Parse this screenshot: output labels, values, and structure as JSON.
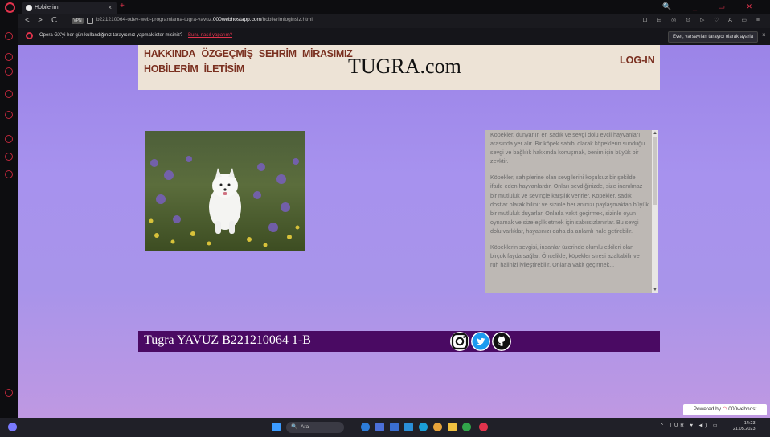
{
  "browser": {
    "tab_title": "Hobilerim",
    "tab_close": "×",
    "new_tab": "+",
    "window_controls": "🔍 _ ▭ ✕",
    "url_prefix": "b221210064-odev-web-programlama-tugra-yavuz.",
    "url_host": "000webhostapp.com",
    "url_path": "/hobilerimloginsiz.html",
    "vpn_label": "VPN",
    "nav_back": "<",
    "nav_forward": ">",
    "nav_reload": "C"
  },
  "infobar": {
    "message": "Opera GX'yi her gün kullandığınız tarayıcınız yapmak ister misiniz?",
    "link": "Bunu nasıl yaparım?",
    "button": "Evet, varsayılan tarayıcı olarak ayarla",
    "close": "×"
  },
  "page": {
    "nav_line1": [
      "HAKKINDA",
      "ÖZGEÇMİŞ",
      "SEHRİM",
      "MİRASIMIZ"
    ],
    "nav_line2": [
      "HOBİLERİM",
      "İLETİSİM"
    ],
    "brand": "TUGRA.com",
    "login": "LOG-IN",
    "paragraphs": [
      "Köpekler, dünyanın en sadık ve sevgi dolu evcil hayvanları arasında yer alır. Bir köpek sahibi olarak köpeklerin sunduğu sevgi ve bağlılık hakkında konuşmak, benim için büyük bir zevktir.",
      "Köpekler, sahiplerine olan sevgilerini koşulsuz bir şekilde ifade eden hayvanlardır. Onları sevdiğinizde, size inanılmaz bir mutluluk ve sevinçle karşılık verirler. Köpekler, sadık dostlar olarak bilinir ve sizinle her anınızı paylaşmaktan büyük bir mutluluk duyarlar. Onlarla vakit geçirmek, sizinle oyun oynamak ve size eşlik etmek için sabırsızlanırlar. Bu sevgi dolu varlıklar, hayatınızı daha da anlamlı hale getirebilir.",
      "Köpeklerin sevgisi, insanlar üzerinde olumlu etkileri olan birçok fayda sağlar. Öncelikle, köpekler stresi azaltabilir ve ruh halinizi iyileştirebilir. Onlarla vakit geçirmek..."
    ],
    "footer_text": "Tugra YAVUZ B221210064 1-B",
    "social_icons": [
      "instagram-icon",
      "twitter-icon",
      "github-icon"
    ]
  },
  "powered_by": {
    "label": "Powered by",
    "brand": "000webhost"
  },
  "taskbar": {
    "search_placeholder": "Ara",
    "search_icon": "🔍",
    "tray": "^ TUR ♥ ◀) ▭",
    "time": "14:23",
    "date": "21.05.2023"
  },
  "colors": {
    "accent": "#e1334c",
    "nav_text": "#7a3020",
    "footer_bg": "#4a0a63",
    "header_bg": "#ede3d6"
  }
}
